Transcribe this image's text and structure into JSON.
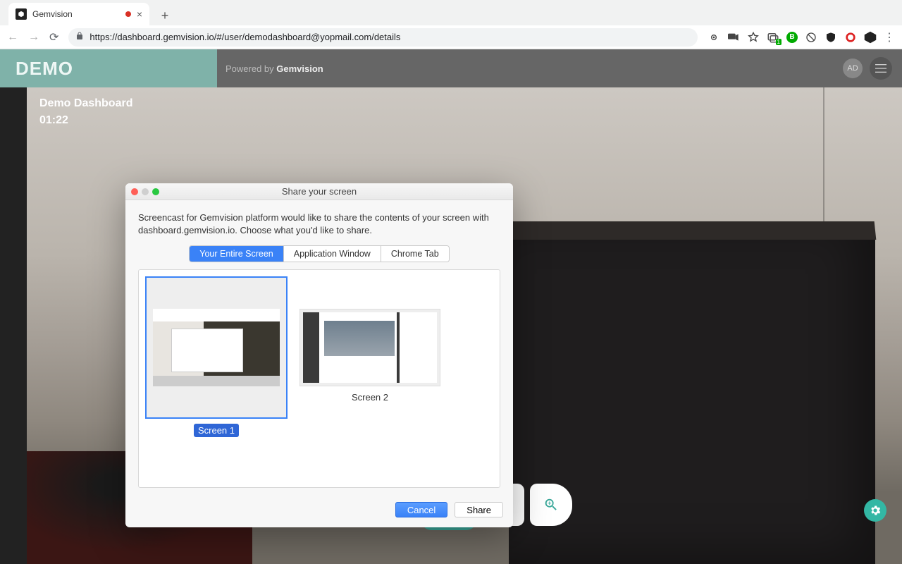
{
  "browser": {
    "tab_title": "Gemvision",
    "url": "https://dashboard.gemvision.io/#/user/demodashboard@yopmail.com/details"
  },
  "header": {
    "logo_text": "DEMO",
    "powered_prefix": "Powered by ",
    "powered_brand": "Gemvision",
    "avatar_initials": "AD"
  },
  "sidebar": {
    "title": "Demo Dashboard",
    "timer": "01:22"
  },
  "dialog": {
    "window_title": "Share your screen",
    "description": "Screencast for Gemvision platform would like to share the contents of your screen with dashboard.gemvision.io. Choose what you'd like to share.",
    "segments": [
      "Your Entire Screen",
      "Application Window",
      "Chrome Tab"
    ],
    "active_segment_index": 0,
    "screens": [
      {
        "label": "Screen 1",
        "selected": true
      },
      {
        "label": "Screen 2",
        "selected": false
      }
    ],
    "cancel_label": "Cancel",
    "share_label": "Share"
  },
  "dock": {
    "icons": [
      "end-call",
      "microphone",
      "camera",
      "screen-share",
      "zoom-in"
    ]
  }
}
